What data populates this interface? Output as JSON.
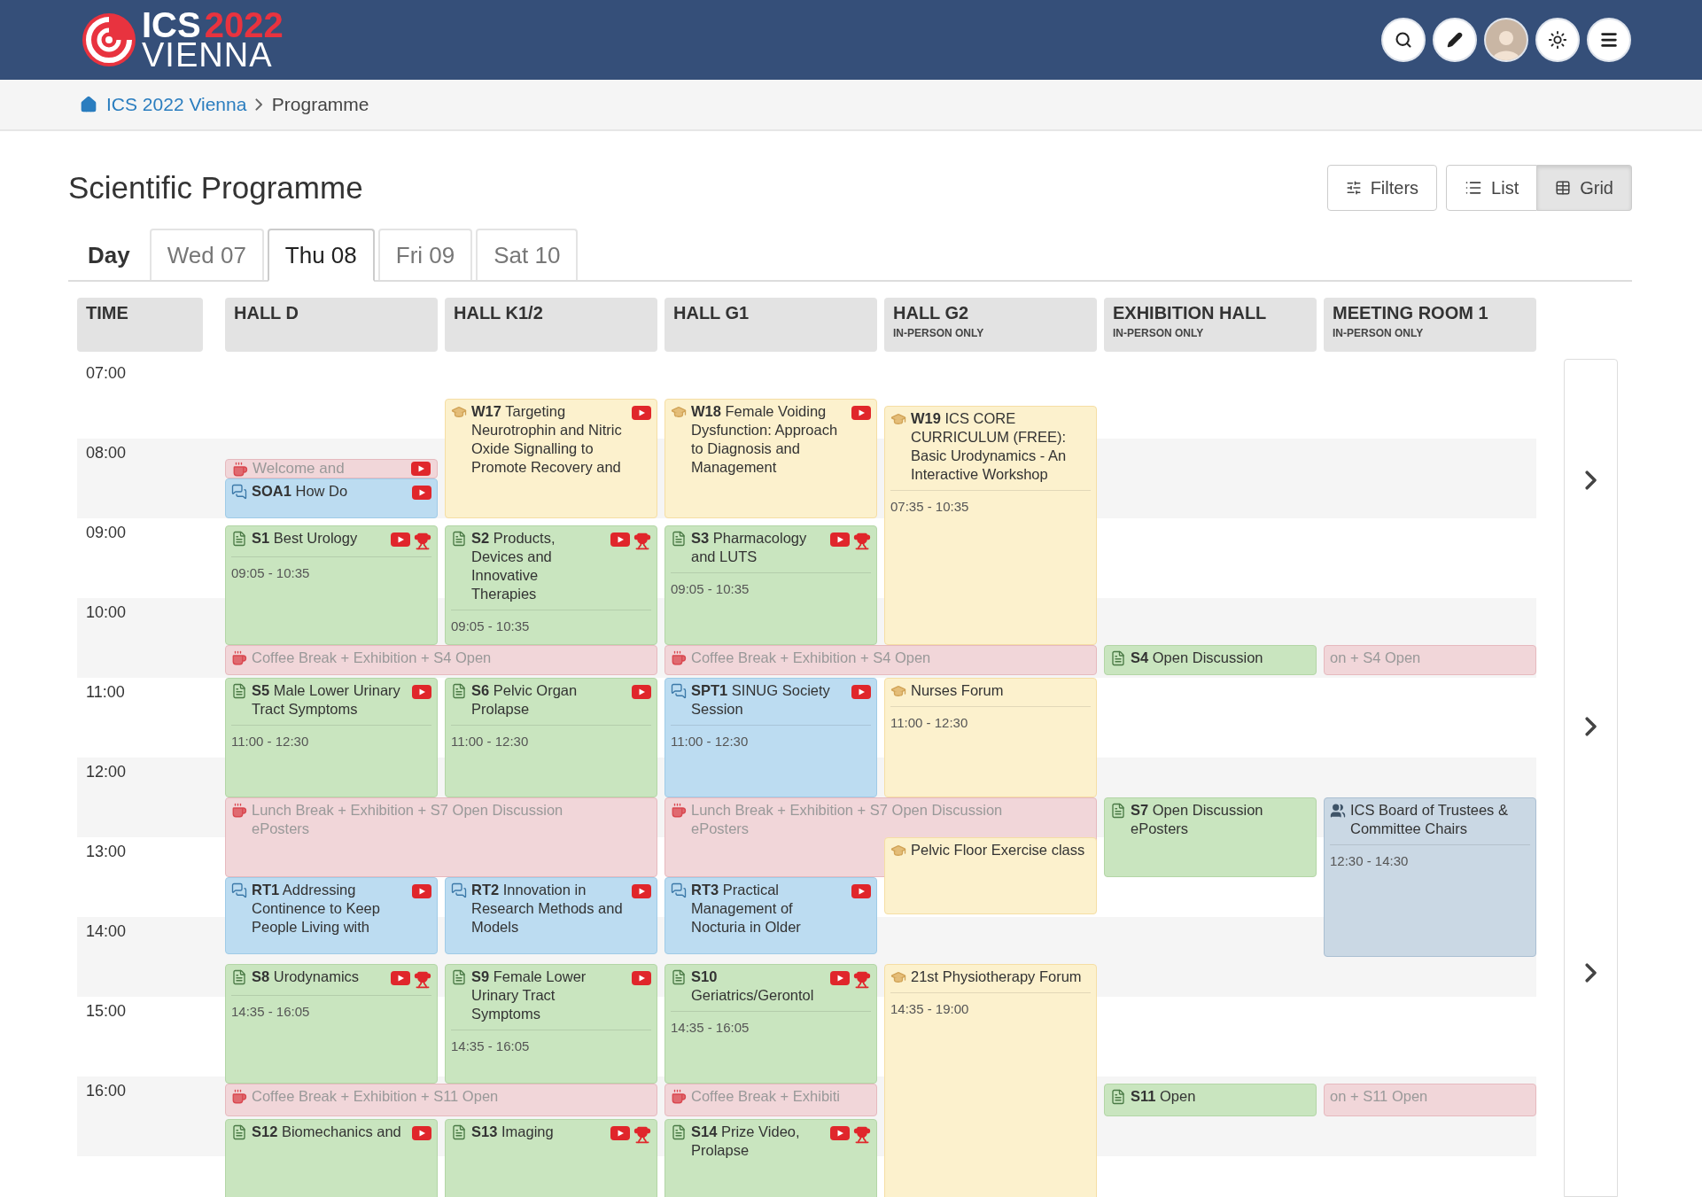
{
  "header": {
    "logo": {
      "brand": "ICS",
      "year": "2022",
      "city": "VIENNA"
    }
  },
  "breadcrumb": {
    "home": "ICS 2022 Vienna",
    "current": "Programme"
  },
  "page_title": "Scientific Programme",
  "toolbar": {
    "filters": "Filters",
    "views": [
      {
        "label": "List",
        "selected": false
      },
      {
        "label": "Grid",
        "selected": true
      }
    ]
  },
  "day_tabs": {
    "label": "Day",
    "tabs": [
      {
        "label": "Wed 07",
        "selected": false
      },
      {
        "label": "Thu 08",
        "selected": true
      },
      {
        "label": "Fri 09",
        "selected": false
      },
      {
        "label": "Sat 10",
        "selected": false
      }
    ]
  },
  "columns": [
    {
      "name": "TIME"
    },
    {
      "name": "HALL D"
    },
    {
      "name": "HALL K1/2"
    },
    {
      "name": "HALL G1"
    },
    {
      "name": "HALL G2",
      "note": "IN-PERSON ONLY"
    },
    {
      "name": "EXHIBITION HALL",
      "note": "IN-PERSON ONLY"
    },
    {
      "name": "MEETING ROOM 1",
      "note": "IN-PERSON ONLY"
    }
  ],
  "times": [
    "07:00",
    "08:00",
    "09:00",
    "10:00",
    "11:00",
    "12:00",
    "13:00",
    "14:00",
    "15:00",
    "16:00"
  ],
  "events": [
    {
      "kind": "break",
      "title": "Welcome and",
      "video": true,
      "prize": false
    },
    {
      "kind": "symposium",
      "title": "**SOA1** How Do",
      "video": true,
      "prize": false
    },
    {
      "kind": "workshop",
      "title": "**W17** Targeting Neurotrophin and Nitric Oxide Signalling to Promote Recovery and",
      "video": true,
      "prize": false
    },
    {
      "kind": "workshop",
      "title": "**W18** Female Voiding Dysfunction: Approach to Diagnosis and Management",
      "video": true,
      "prize": false
    },
    {
      "kind": "workshop",
      "title": "**W19** ICS CORE CURRICULUM (FREE): Basic Urodynamics - An Interactive Workshop",
      "time": "07:35 - 10:35",
      "video": false,
      "prize": false
    },
    {
      "kind": "session",
      "title": "**S1** Best Urology",
      "time": "09:05 - 10:35",
      "video": true,
      "prize": true
    },
    {
      "kind": "session",
      "title": "**S2** Products, Devices and Innovative Therapies",
      "time": "09:05 - 10:35",
      "video": true,
      "prize": true
    },
    {
      "kind": "session",
      "title": "**S3** Pharmacology and LUTS",
      "time": "09:05 - 10:35",
      "video": true,
      "prize": true
    },
    {
      "kind": "break",
      "title": "Coffee Break + Exhibition + S4 Open",
      "video": false,
      "prize": false
    },
    {
      "kind": "break",
      "title": "Coffee Break + Exhibition + S4 Open",
      "video": false,
      "prize": false
    },
    {
      "kind": "session",
      "title": "**S4** Open Discussion",
      "video": false,
      "prize": false
    },
    {
      "kind": "break_tail",
      "title": "on + S4 Open",
      "video": false,
      "prize": false
    },
    {
      "kind": "session",
      "title": "**S5** Male Lower Urinary Tract Symptoms",
      "time": "11:00 - 12:30",
      "video": true,
      "prize": false
    },
    {
      "kind": "session",
      "title": "**S6** Pelvic Organ Prolapse",
      "time": "11:00 - 12:30",
      "video": true,
      "prize": false
    },
    {
      "kind": "symposium",
      "title": "**SPT1** SINUG Society Session",
      "time": "11:00 - 12:30",
      "video": true,
      "prize": false
    },
    {
      "kind": "workshop",
      "title": "Nurses Forum",
      "time": "11:00 - 12:30",
      "video": false,
      "prize": false
    },
    {
      "kind": "break",
      "title": "Lunch Break + Exhibition + S7 Open Discussion ePosters",
      "video": false,
      "prize": false
    },
    {
      "kind": "break",
      "title": "Lunch Break + Exhibition + S7 Open Discussion ePosters",
      "video": false,
      "prize": false
    },
    {
      "kind": "workshop",
      "title": "Pelvic Floor Exercise class",
      "video": false,
      "prize": false
    },
    {
      "kind": "session",
      "title": "**S7** Open Discussion ePosters",
      "video": false,
      "prize": false
    },
    {
      "kind": "meeting",
      "title": "ICS Board of Trustees & Committee Chairs",
      "time": "12:30 - 14:30",
      "video": false,
      "prize": false
    },
    {
      "kind": "symposium",
      "title": "**RT1** Addressing Continence to Keep People Living with",
      "video": true,
      "prize": false
    },
    {
      "kind": "symposium",
      "title": "**RT2** Innovation in Research Methods and Models",
      "video": true,
      "prize": false
    },
    {
      "kind": "symposium",
      "title": "**RT3** Practical Management of Nocturia in Older",
      "video": true,
      "prize": false
    },
    {
      "kind": "session",
      "title": "**S8** Urodynamics",
      "time": "14:35 - 16:05",
      "video": true,
      "prize": true
    },
    {
      "kind": "session",
      "title": "**S9** Female Lower Urinary Tract Symptoms",
      "time": "14:35 - 16:05",
      "video": true,
      "prize": false
    },
    {
      "kind": "session",
      "title": "**S10** Geriatrics/Gerontol",
      "time": "14:35 - 16:05",
      "video": true,
      "prize": true
    },
    {
      "kind": "workshop",
      "title": "21st Physiotherapy Forum",
      "time": "14:35 - 19:00",
      "video": false,
      "prize": false
    },
    {
      "kind": "break",
      "title": "Coffee Break + Exhibition + S11 Open",
      "video": false,
      "prize": false
    },
    {
      "kind": "break",
      "title": "Coffee Break + Exhibiti",
      "video": false,
      "prize": false
    },
    {
      "kind": "session",
      "title": "**S11** Open",
      "video": false,
      "prize": false
    },
    {
      "kind": "break_tail",
      "title": "on + S11 Open",
      "video": false,
      "prize": false
    },
    {
      "kind": "session",
      "title": "**S12** Biomechanics and",
      "video": true,
      "prize": false
    },
    {
      "kind": "session",
      "title": "**S13** Imaging",
      "video": true,
      "prize": true
    },
    {
      "kind": "session",
      "title": "**S14** Prize Video, Prolapse",
      "video": true,
      "prize": true
    }
  ]
}
